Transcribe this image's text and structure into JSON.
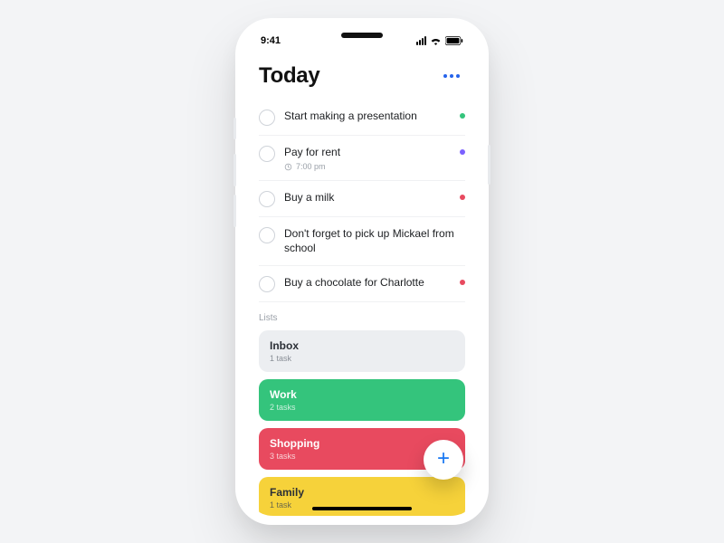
{
  "status": {
    "time": "9:41"
  },
  "header": {
    "title": "Today"
  },
  "tasks": [
    {
      "title": "Start making a presentation",
      "time": "",
      "color": "#34c47c"
    },
    {
      "title": "Pay for rent",
      "time": "7:00 pm",
      "color": "#7b61ff"
    },
    {
      "title": "Buy a milk",
      "time": "",
      "color": "#e84a5f"
    },
    {
      "title": "Don't forget to pick up Mickael from school",
      "time": "",
      "color": ""
    },
    {
      "title": "Buy a chocolate for Charlotte",
      "time": "",
      "color": "#e84a5f"
    }
  ],
  "sections": {
    "lists_label": "Lists"
  },
  "lists": [
    {
      "name": "Inbox",
      "sub": "1 task"
    },
    {
      "name": "Work",
      "sub": "2 tasks"
    },
    {
      "name": "Shopping",
      "sub": "3 tasks"
    },
    {
      "name": "Family",
      "sub": "1 task"
    }
  ],
  "colors": {
    "accent_blue": "#1877f2",
    "green": "#34c47c",
    "red": "#e84a5f",
    "yellow": "#f6d23a",
    "purple": "#7b61ff"
  }
}
